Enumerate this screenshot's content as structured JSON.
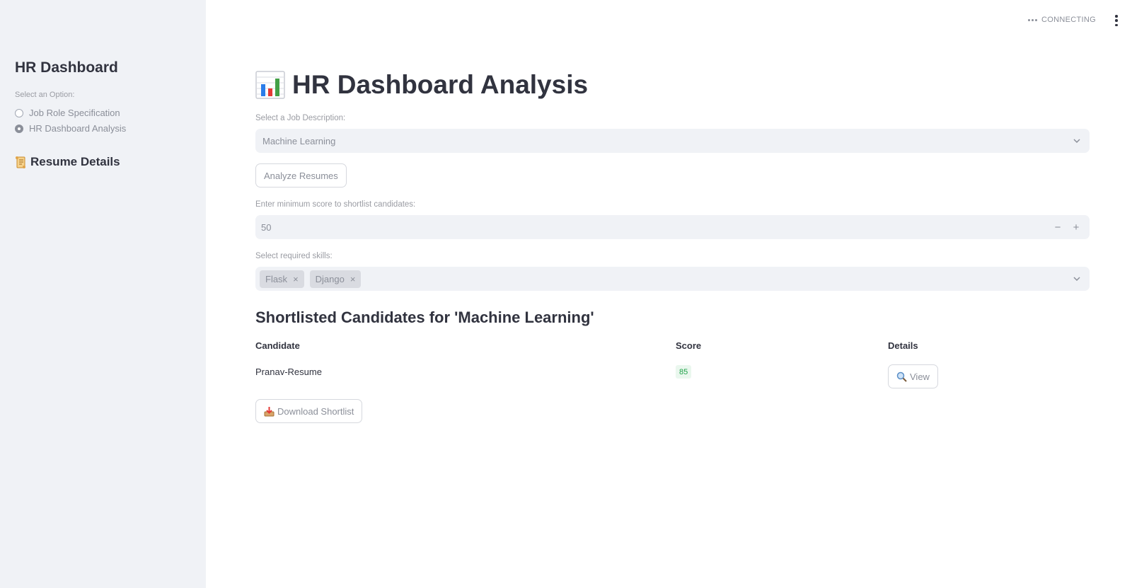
{
  "sidebar": {
    "title": "HR Dashboard",
    "option_label": "Select an Option:",
    "options": [
      {
        "label": "Job Role Specification",
        "selected": false
      },
      {
        "label": "HR Dashboard Analysis",
        "selected": true
      }
    ],
    "section_title": "Resume Details",
    "section_icon": "scroll-icon"
  },
  "header": {
    "status": "CONNECTING",
    "menu_icon": "kebab-menu-icon"
  },
  "main": {
    "title": "HR Dashboard Analysis",
    "title_icon": "bar-chart-icon",
    "job_label": "Select a Job Description:",
    "job_value": "Machine Learning",
    "analyze_button": "Analyze Resumes",
    "score_label": "Enter minimum score to shortlist candidates:",
    "score_value": "50",
    "minus": "−",
    "plus": "+",
    "skills_label": "Select required skills:",
    "skills": [
      "Flask",
      "Django"
    ],
    "shortlist_title": "Shortlisted Candidates for 'Machine Learning'",
    "table": {
      "columns": [
        "Candidate",
        "Score",
        "Details"
      ],
      "rows": [
        {
          "candidate": "Pranav-Resume",
          "score": "85",
          "details_button": "View"
        }
      ]
    },
    "download_button": "Download Shortlist"
  },
  "colors": {
    "sidebar_bg": "#f0f2f6",
    "input_bg": "#f0f2f6",
    "text": "#31333f",
    "muted": "#8b8f99",
    "score_green": "#21a34a"
  }
}
